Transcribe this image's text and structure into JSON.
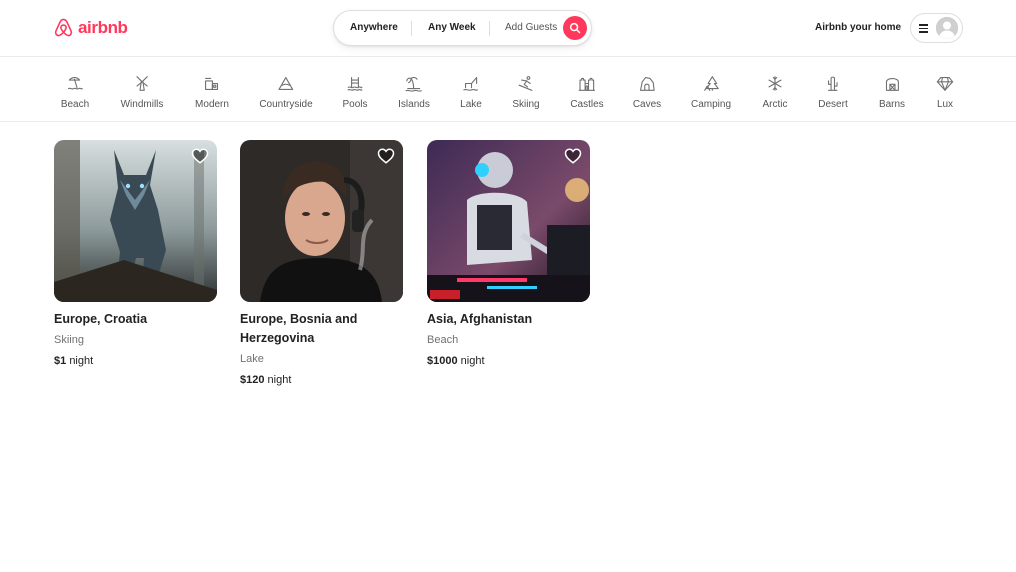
{
  "header": {
    "logo_text": "airbnb",
    "search": {
      "location": "Anywhere",
      "week": "Any Week",
      "guests": "Add Guests"
    },
    "host_link": "Airbnb your home",
    "brand_color": "#FF385C"
  },
  "categories": [
    {
      "label": "Beach",
      "icon": "beach-icon"
    },
    {
      "label": "Windmills",
      "icon": "windmill-icon"
    },
    {
      "label": "Modern",
      "icon": "modern-house-icon"
    },
    {
      "label": "Countryside",
      "icon": "countryside-icon"
    },
    {
      "label": "Pools",
      "icon": "pool-icon"
    },
    {
      "label": "Islands",
      "icon": "island-icon"
    },
    {
      "label": "Lake",
      "icon": "lake-icon"
    },
    {
      "label": "Skiing",
      "icon": "skiing-icon"
    },
    {
      "label": "Castles",
      "icon": "castle-icon"
    },
    {
      "label": "Caves",
      "icon": "cave-icon"
    },
    {
      "label": "Camping",
      "icon": "camping-icon"
    },
    {
      "label": "Arctic",
      "icon": "snowflake-icon"
    },
    {
      "label": "Desert",
      "icon": "cactus-icon"
    },
    {
      "label": "Barns",
      "icon": "barn-icon"
    },
    {
      "label": "Lux",
      "icon": "diamond-icon"
    }
  ],
  "listings": [
    {
      "title": "Europe, Croatia",
      "category": "Skiing",
      "price": "$1",
      "price_suffix": "night"
    },
    {
      "title": "Europe, Bosnia and Herzegovina",
      "category": "Lake",
      "price": "$120",
      "price_suffix": "night"
    },
    {
      "title": "Asia, Afghanistan",
      "category": "Beach",
      "price": "$1000",
      "price_suffix": "night"
    }
  ]
}
